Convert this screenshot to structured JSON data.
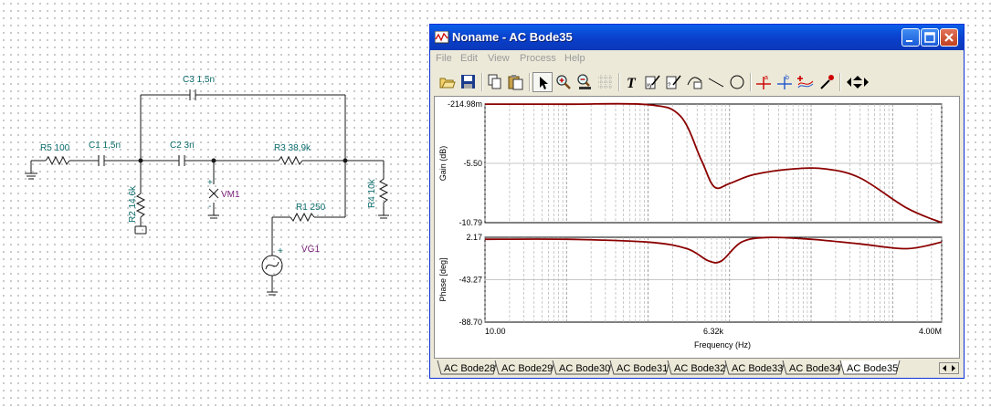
{
  "schematic": {
    "components": [
      {
        "ref": "R5",
        "value": "100",
        "label": "R5 100"
      },
      {
        "ref": "C1",
        "value": "1,5n",
        "label": "C1 1,5n"
      },
      {
        "ref": "C2",
        "value": "3n",
        "label": "C2 3n"
      },
      {
        "ref": "C3",
        "value": "1,5n",
        "label": "C3 1,5n"
      },
      {
        "ref": "R3",
        "value": "38,9k",
        "label": "R3 38,9k"
      },
      {
        "ref": "R1",
        "value": "250",
        "label": "R1 250"
      },
      {
        "ref": "R2",
        "value": "14,6k",
        "label": "R2 14,6k"
      },
      {
        "ref": "R4",
        "value": "10k",
        "label": "R4 10k"
      },
      {
        "ref": "VM1",
        "value": "",
        "label": "VM1"
      },
      {
        "ref": "VG1",
        "value": "",
        "label": "VG1"
      }
    ],
    "plus": "+",
    "minus": "-"
  },
  "window": {
    "title": "Noname - AC Bode35",
    "colors": {
      "titlebar": "#0a5fe8",
      "curve": "#8b0000",
      "window_bg": "#ece9d8"
    },
    "menu": [
      "File",
      "Edit",
      "View",
      "Process",
      "Help"
    ],
    "toolbar_icons": [
      "open-icon",
      "save-icon",
      "copy-icon",
      "paste-icon",
      "pointer-icon",
      "zoom-in-icon",
      "zoom-100-icon",
      "grid-icon",
      "text-icon",
      "label-icon",
      "label2-icon",
      "curve-label-icon",
      "line-icon",
      "circle-icon",
      "cursor-a-icon",
      "cursor-b-icon",
      "add-curve-icon",
      "pick-color-icon",
      "move-cursor-icon"
    ]
  },
  "chart_data": [
    {
      "type": "line",
      "title": "",
      "xlabel": "Frequency (Hz)",
      "ylabel": "Gain (dB)",
      "x_scale": "log",
      "xlim": [
        10,
        4000000
      ],
      "ylim": [
        -10.79,
        -0.21498
      ],
      "x_tick_labels": [
        "10.00",
        "6.32k",
        "4.00M"
      ],
      "y_tick_labels": [
        "-214.98m",
        "-5.50",
        "-10.79"
      ],
      "series": [
        {
          "x": [
            10,
            100,
            1000,
            2500,
            4500,
            6500,
            10000,
            20000,
            60000,
            150000,
            400000,
            1500000,
            4000000
          ],
          "y": [
            -0.22,
            -0.23,
            -0.27,
            -1.3,
            -5.2,
            -7.6,
            -7.3,
            -6.5,
            -6.0,
            -6.0,
            -6.8,
            -9.5,
            -10.79
          ]
        }
      ]
    },
    {
      "type": "line",
      "title": "",
      "xlabel": "Frequency (Hz)",
      "ylabel": "Phase [deg]",
      "x_scale": "log",
      "xlim": [
        10,
        4000000
      ],
      "ylim": [
        -88.7,
        2.17
      ],
      "x_tick_labels": [
        "10.00",
        "6.32k",
        "4.00M"
      ],
      "y_tick_labels": [
        "2.17",
        "-43.27",
        "-88.70"
      ],
      "series": [
        {
          "x": [
            10,
            100,
            1000,
            3000,
            5500,
            8000,
            14000,
            30000,
            100000,
            400000,
            1500000,
            4000000
          ],
          "y": [
            0,
            0,
            -3,
            -10,
            -23,
            -23,
            -3,
            2,
            0,
            -5,
            -10,
            -3
          ]
        }
      ]
    }
  ],
  "tabs": [
    "AC Bode28",
    "AC Bode29",
    "AC Bode30",
    "AC Bode31",
    "AC Bode32",
    "AC Bode33",
    "AC Bode34",
    "AC Bode35"
  ],
  "active_tab": "AC Bode35"
}
